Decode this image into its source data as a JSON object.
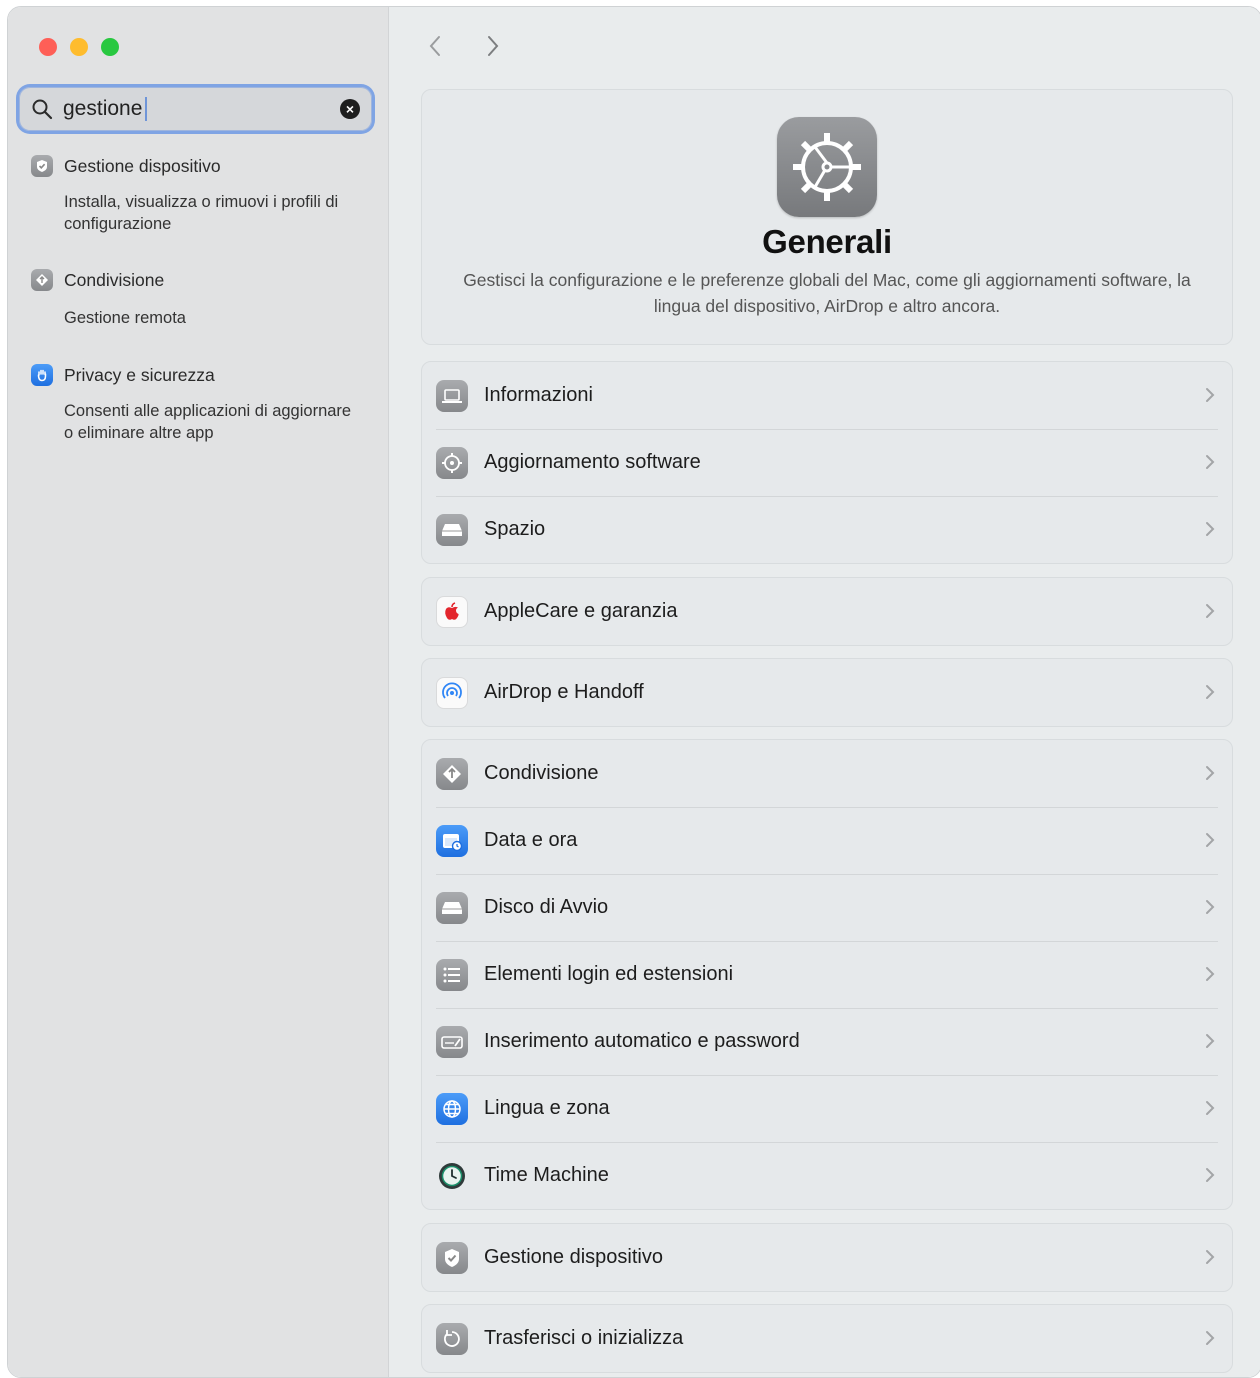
{
  "sidebar": {
    "search": {
      "value": "gestione"
    },
    "results": [
      {
        "title": "Gestione dispositivo",
        "subtitle": "Installa, visualizza o rimuovi i profili di configurazione",
        "icon": "checkmark-badge-icon"
      },
      {
        "title": "Condivisione",
        "subtitle": "Gestione remota",
        "icon": "sharing-icon"
      },
      {
        "title": "Privacy e sicurezza",
        "subtitle": "Consenti alle applicazioni di aggiornare o eliminare altre app",
        "icon": "hand-icon"
      }
    ]
  },
  "header": {
    "title": "Generali",
    "description": "Gestisci la configurazione e le preferenze globali del Mac, come gli aggiornamenti software, la lingua del dispositivo, AirDrop e altro ancora."
  },
  "groups": [
    [
      {
        "label": "Informazioni",
        "icon": "laptop-icon"
      },
      {
        "label": "Aggiornamento software",
        "icon": "gear-refresh-icon"
      },
      {
        "label": "Spazio",
        "icon": "drive-icon"
      }
    ],
    [
      {
        "label": "AppleCare e garanzia",
        "icon": "apple-icon"
      }
    ],
    [
      {
        "label": "AirDrop e Handoff",
        "icon": "airdrop-icon"
      }
    ],
    [
      {
        "label": "Condivisione",
        "icon": "sharing-icon"
      },
      {
        "label": "Data e ora",
        "icon": "calendar-clock-icon"
      },
      {
        "label": "Disco di Avvio",
        "icon": "drive-icon"
      },
      {
        "label": "Elementi login ed estensioni",
        "icon": "list-icon"
      },
      {
        "label": "Inserimento automatico e password",
        "icon": "password-icon"
      },
      {
        "label": "Lingua e zona",
        "icon": "globe-icon"
      },
      {
        "label": "Time Machine",
        "icon": "time-machine-icon"
      }
    ],
    [
      {
        "label": "Gestione dispositivo",
        "icon": "checkmark-badge-icon"
      }
    ],
    [
      {
        "label": "Trasferisci o inizializza",
        "icon": "reset-icon"
      }
    ]
  ],
  "colors": {
    "accent": "#2f7bf0",
    "focus_ring": "#7fa4e4",
    "sidebar_bg": "#e1e2e3",
    "main_bg": "#e9eced"
  }
}
